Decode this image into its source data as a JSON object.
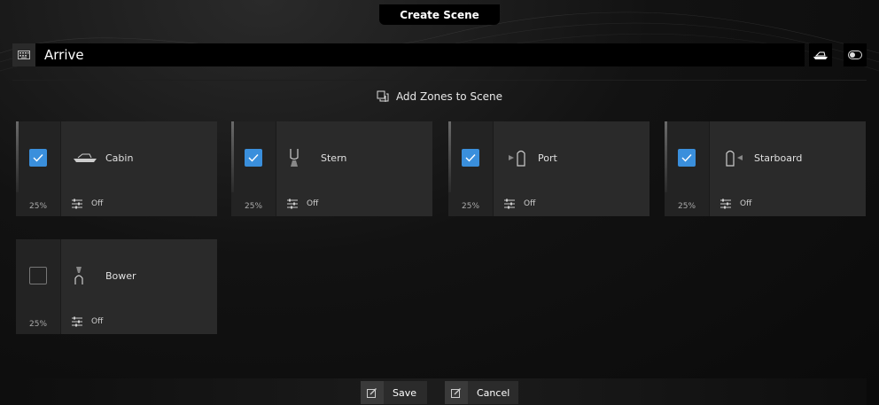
{
  "header": {
    "title": "Create Scene"
  },
  "scene": {
    "name": "Arrive"
  },
  "zones_header": {
    "label": "Add Zones to Scene"
  },
  "zones": [
    {
      "name": "Cabin",
      "percent": "25%",
      "state": "Off",
      "checked": true,
      "icon": "boat-icon"
    },
    {
      "name": "Stern",
      "percent": "25%",
      "state": "Off",
      "checked": true,
      "icon": "stern-light-icon"
    },
    {
      "name": "Port",
      "percent": "25%",
      "state": "Off",
      "checked": true,
      "icon": "port-light-icon"
    },
    {
      "name": "Starboard",
      "percent": "25%",
      "state": "Off",
      "checked": true,
      "icon": "starboard-light-icon"
    },
    {
      "name": "Bower",
      "percent": "25%",
      "state": "Off",
      "checked": false,
      "icon": "bow-light-icon"
    }
  ],
  "footer": {
    "save_label": "Save",
    "cancel_label": "Cancel"
  },
  "colors": {
    "accent": "#3a8fdc",
    "background": "#0b0b0b",
    "card": "#2a2a2a"
  }
}
